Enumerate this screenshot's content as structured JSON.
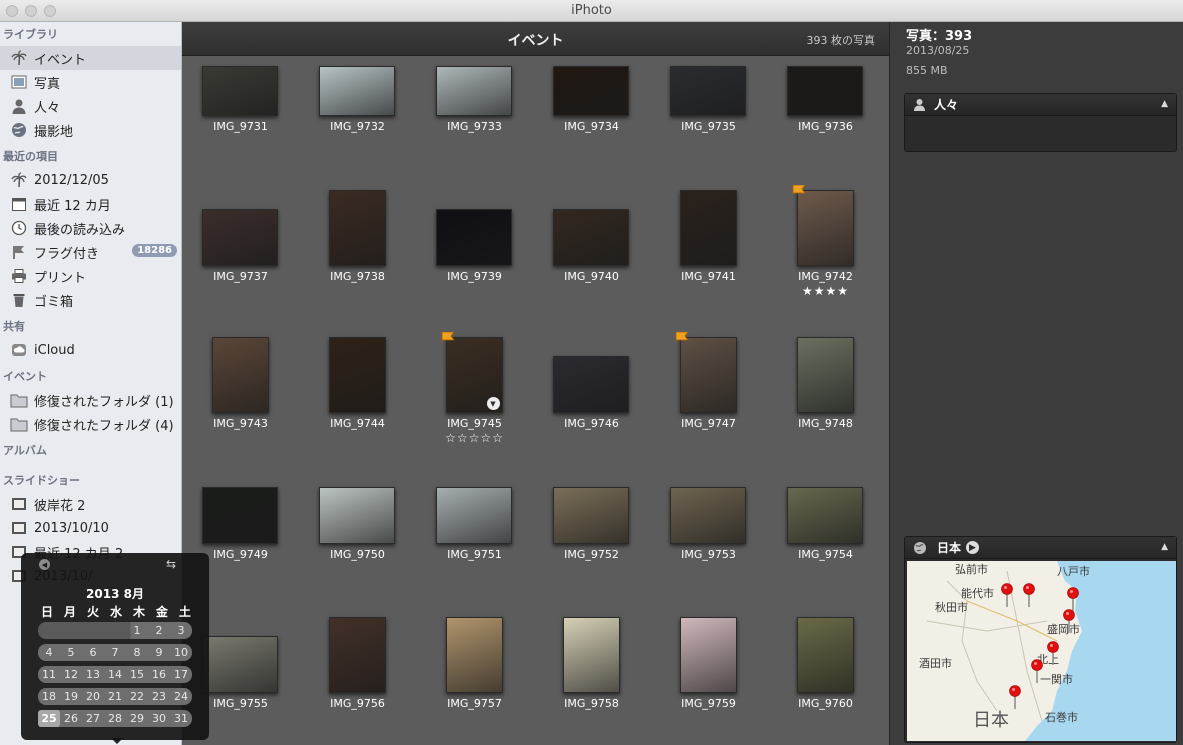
{
  "window": {
    "title": "iPhoto"
  },
  "sidebar": {
    "sections": [
      {
        "title": "ライブラリ",
        "items": [
          {
            "label": "イベント",
            "icon": "palm-icon",
            "selected": true
          },
          {
            "label": "写真",
            "icon": "photo-icon"
          },
          {
            "label": "人々",
            "icon": "person-icon"
          },
          {
            "label": "撮影地",
            "icon": "globe-icon"
          }
        ]
      },
      {
        "title": "最近の項目",
        "items": [
          {
            "label": "2012/12/05",
            "icon": "palm-icon"
          },
          {
            "label": "最近 12 カ月",
            "icon": "calendar-icon"
          },
          {
            "label": "最後の読み込み",
            "icon": "clock-icon"
          },
          {
            "label": "フラグ付き",
            "icon": "flag-icon",
            "badge": "18286"
          },
          {
            "label": "プリント",
            "icon": "printer-icon"
          },
          {
            "label": "ゴミ箱",
            "icon": "trash-icon"
          }
        ]
      },
      {
        "title": "共有",
        "items": [
          {
            "label": "iCloud",
            "icon": "cloud-icon"
          }
        ]
      },
      {
        "title": "イベント",
        "items": [
          {
            "label": "修復されたフォルダ (1)",
            "icon": "folder-icon"
          },
          {
            "label": "修復されたフォルダ (4)",
            "icon": "folder-icon"
          }
        ]
      },
      {
        "title": "アルバム",
        "items": []
      },
      {
        "title": "スライドショー",
        "items": [
          {
            "label": "彼岸花 2",
            "icon": "slideshow-icon"
          },
          {
            "label": "2013/10/10",
            "icon": "slideshow-icon"
          },
          {
            "label": "最近 12 カ月 2",
            "icon": "slideshow-icon"
          },
          {
            "label": "2013/10/",
            "icon": "slideshow-icon"
          }
        ]
      }
    ]
  },
  "main": {
    "title": "イベント",
    "count": "393 枚の写真",
    "photos": [
      {
        "name": "IMG_9731",
        "tone": "#3a3a34"
      },
      {
        "name": "IMG_9732",
        "tone": "#b7c3c6"
      },
      {
        "name": "IMG_9733",
        "tone": "#aeb7b8"
      },
      {
        "name": "IMG_9734",
        "tone": "#201812"
      },
      {
        "name": "IMG_9735",
        "tone": "#2a2c30"
      },
      {
        "name": "IMG_9736",
        "tone": "#1c1a18"
      },
      {
        "name": "IMG_9737",
        "tone": "#3a2e2c"
      },
      {
        "name": "IMG_9738",
        "tone": "#3b2b22"
      },
      {
        "name": "IMG_9739",
        "tone": "#0f0f14"
      },
      {
        "name": "IMG_9740",
        "tone": "#322820"
      },
      {
        "name": "IMG_9741",
        "tone": "#2a221c"
      },
      {
        "name": "IMG_9742",
        "tone": "#6e5a4c",
        "flag": true,
        "stars": "★★★★"
      },
      {
        "name": "IMG_9743",
        "tone": "#5b4638"
      },
      {
        "name": "IMG_9744",
        "tone": "#2e2218"
      },
      {
        "name": "IMG_9745",
        "tone": "#3a2e22",
        "flag": true,
        "stars": "☆☆☆☆☆",
        "menu": true
      },
      {
        "name": "IMG_9746",
        "tone": "#2a2a30"
      },
      {
        "name": "IMG_9747",
        "tone": "#5e5044",
        "flag": true
      },
      {
        "name": "IMG_9748",
        "tone": "#6a7060"
      },
      {
        "name": "IMG_9749",
        "tone": "#1a1c1a"
      },
      {
        "name": "IMG_9750",
        "tone": "#bcc4c2"
      },
      {
        "name": "IMG_9751",
        "tone": "#a6aeb0"
      },
      {
        "name": "IMG_9752",
        "tone": "#7a6e58"
      },
      {
        "name": "IMG_9753",
        "tone": "#6e6450"
      },
      {
        "name": "IMG_9754",
        "tone": "#66684e"
      },
      {
        "name": "IMG_9755",
        "tone": "#7a7a70"
      },
      {
        "name": "IMG_9756",
        "tone": "#423028"
      },
      {
        "name": "IMG_9757",
        "tone": "#b0946c"
      },
      {
        "name": "IMG_9758",
        "tone": "#d6d0b6"
      },
      {
        "name": "IMG_9759",
        "tone": "#d0b8bc"
      },
      {
        "name": "IMG_9760",
        "tone": "#6a6a48"
      }
    ]
  },
  "info": {
    "title": "写真：393",
    "date": "2013/08/25",
    "size": "855 MB",
    "people_panel": {
      "label": "人々"
    },
    "map_panel": {
      "label": "日本",
      "places": [
        "八戸市",
        "能代市",
        "弘前市",
        "秋田市",
        "盛岡市",
        "酒田市",
        "北上",
        "一関市",
        "日本",
        "石巻市"
      ]
    }
  },
  "calendar": {
    "month": "2013 8月",
    "weekdays": [
      "日",
      "月",
      "火",
      "水",
      "木",
      "金",
      "土"
    ],
    "weeks": [
      [
        "",
        "",
        "",
        "",
        "1",
        "2",
        "3"
      ],
      [
        "4",
        "5",
        "6",
        "7",
        "8",
        "9",
        "10"
      ],
      [
        "11",
        "12",
        "13",
        "14",
        "15",
        "16",
        "17"
      ],
      [
        "18",
        "19",
        "20",
        "21",
        "22",
        "23",
        "24"
      ],
      [
        "25",
        "26",
        "27",
        "28",
        "29",
        "30",
        "31"
      ]
    ],
    "selected": "25"
  },
  "colors": {
    "flag": "#f0a020",
    "map_water": "#a8d8ef",
    "map_land": "#f2efe6",
    "pin": "#e01010"
  }
}
